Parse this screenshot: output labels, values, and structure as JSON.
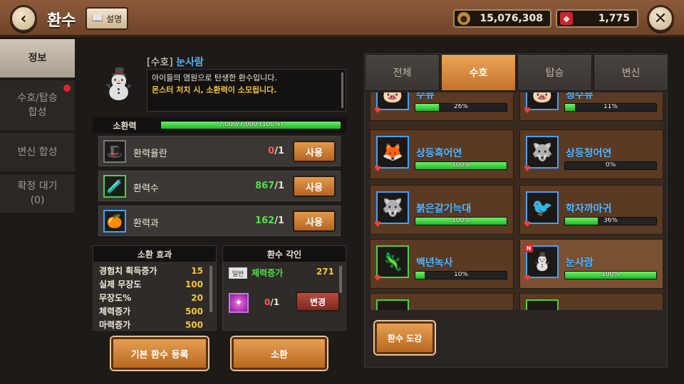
{
  "header": {
    "title": "환수",
    "help_label": "설명",
    "gold": "15,076,308",
    "ruby": "1,775"
  },
  "sidebar": {
    "items": [
      {
        "label": "정보",
        "active": true
      },
      {
        "label": "수호/탑승",
        "label2": "합성",
        "badge": true
      },
      {
        "label": "변신 합성"
      },
      {
        "label": "확정 대기",
        "label2": "(0)"
      }
    ]
  },
  "pet": {
    "tag": "[수호]",
    "name": "눈사람",
    "desc1": "아이들의 염원으로 탄생한 환수입니다.",
    "desc2": "몬스터 처치 시, 소환력이 소모됩니다."
  },
  "summon_power": {
    "label": "소환력",
    "text": "7,000/7,000 (100%)",
    "fraction": 1.0
  },
  "items": [
    {
      "name": "환력율란",
      "have": "0",
      "need": "/1",
      "enough": false,
      "button": "사용"
    },
    {
      "name": "환력수",
      "have": "867",
      "need": "/1",
      "enough": true,
      "button": "사용"
    },
    {
      "name": "환력과",
      "have": "162",
      "need": "/1",
      "enough": true,
      "button": "사용"
    }
  ],
  "effects": {
    "title": "소환 효과",
    "rows": [
      {
        "name": "경험치 획득증가",
        "value": "15"
      },
      {
        "name": "실제 무장도",
        "value": "100"
      },
      {
        "name": "무장도%",
        "value": "20"
      },
      {
        "name": "체력증가",
        "value": "500"
      },
      {
        "name": "마력증가",
        "value": "500"
      }
    ]
  },
  "engrave": {
    "title": "환수 각인",
    "badge": "일반",
    "stat_name": "체력증가",
    "stat_value": "271",
    "rune_have": "0",
    "rune_need": "/1",
    "change_label": "변경"
  },
  "buttons": {
    "register": "기본 환수 등록",
    "summon": "소환",
    "encyclopedia": "환수 도감"
  },
  "tabs": [
    {
      "label": "전체"
    },
    {
      "label": "수호",
      "active": true
    },
    {
      "label": "탑승"
    },
    {
      "label": "변신"
    }
  ],
  "pet_list": [
    {
      "name": "수뮤",
      "pct": "26%",
      "fraction": 0.26
    },
    {
      "name": "청수뮤",
      "pct": "11%",
      "fraction": 0.11
    },
    {
      "name": "상등흑어연",
      "pct": "100%",
      "fraction": 1.0
    },
    {
      "name": "상등청어연",
      "pct": "0%",
      "fraction": 0.0
    },
    {
      "name": "붉은갈기늑대",
      "pct": "100%",
      "fraction": 1.0
    },
    {
      "name": "학자까마귀",
      "pct": "36%",
      "fraction": 0.36
    },
    {
      "name": "백년녹사",
      "pct": "10%",
      "fraction": 0.1
    },
    {
      "name": "눈사람",
      "pct": "100%",
      "fraction": 1.0,
      "selected": true,
      "new": true
    }
  ]
}
